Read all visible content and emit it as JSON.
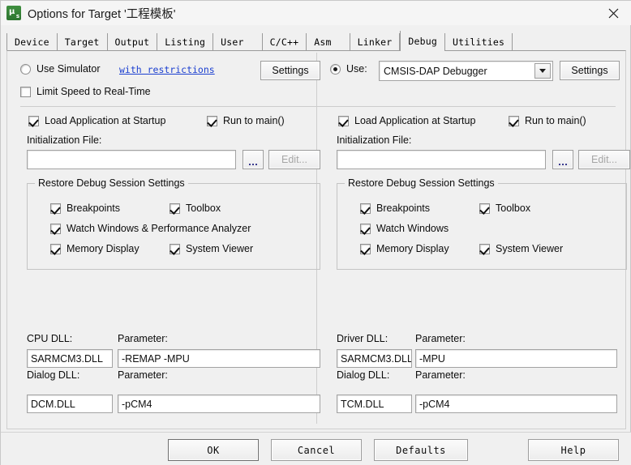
{
  "window": {
    "title": "Options for Target '工程模板'",
    "icon": "uvision-icon",
    "close_label": "✕"
  },
  "tabs": [
    {
      "label": "Device",
      "active": false
    },
    {
      "label": "Target",
      "active": false
    },
    {
      "label": "Output",
      "active": false
    },
    {
      "label": "Listing",
      "active": false
    },
    {
      "label": "User",
      "active": false
    },
    {
      "label": "C/C++",
      "active": false
    },
    {
      "label": "Asm",
      "active": false
    },
    {
      "label": "Linker",
      "active": false
    },
    {
      "label": "Debug",
      "active": true
    },
    {
      "label": "Utilities",
      "active": false
    }
  ],
  "left": {
    "use_simulator_label": "Use Simulator",
    "use_simulator_checked": false,
    "restrictions_link": "with restrictions",
    "settings_label": "Settings",
    "limit_speed_label": "Limit Speed to Real-Time",
    "limit_speed_checked": false,
    "load_app_label": "Load Application at Startup",
    "load_app_checked": true,
    "run_to_main_label": "Run to main()",
    "run_to_main_checked": true,
    "init_file_label": "Initialization File:",
    "init_file_value": "",
    "browse_label": "...",
    "edit_label": "Edit...",
    "edit_disabled": true,
    "restore_group_title": "Restore Debug Session Settings",
    "restore_items": [
      {
        "label": "Breakpoints",
        "checked": true
      },
      {
        "label": "Toolbox",
        "checked": true
      },
      {
        "label": "Watch Windows & Performance Analyzer",
        "checked": true
      },
      {
        "label": "Memory Display",
        "checked": true
      },
      {
        "label": "System Viewer",
        "checked": true
      }
    ],
    "cpu_dll_label": "CPU DLL:",
    "cpu_dll_value": "SARMCM3.DLL",
    "cpu_param_label": "Parameter:",
    "cpu_param_value": "-REMAP -MPU",
    "dialog_dll_label": "Dialog DLL:",
    "dialog_dll_value": "DCM.DLL",
    "dialog_param_label": "Parameter:",
    "dialog_param_value": "-pCM4"
  },
  "right": {
    "use_label": "Use:",
    "use_checked": true,
    "debugger_value": "CMSIS-DAP Debugger",
    "settings_label": "Settings",
    "load_app_label": "Load Application at Startup",
    "load_app_checked": true,
    "run_to_main_label": "Run to main()",
    "run_to_main_checked": true,
    "init_file_label": "Initialization File:",
    "init_file_value": "",
    "browse_label": "...",
    "edit_label": "Edit...",
    "edit_disabled": true,
    "restore_group_title": "Restore Debug Session Settings",
    "restore_items": [
      {
        "label": "Breakpoints",
        "checked": true
      },
      {
        "label": "Toolbox",
        "checked": true
      },
      {
        "label": "Watch Windows",
        "checked": true
      },
      {
        "label": "Memory Display",
        "checked": true
      },
      {
        "label": "System Viewer",
        "checked": true
      }
    ],
    "driver_dll_label": "Driver DLL:",
    "driver_dll_value": "SARMCM3.DLL",
    "driver_param_label": "Parameter:",
    "driver_param_value": "-MPU",
    "dialog_dll_label": "Dialog DLL:",
    "dialog_dll_value": "TCM.DLL",
    "dialog_param_label": "Parameter:",
    "dialog_param_value": "-pCM4"
  },
  "footer": {
    "ok": "OK",
    "cancel": "Cancel",
    "defaults": "Defaults",
    "help": "Help"
  },
  "colors": {
    "dialog_bg": "#f0f0f0",
    "link": "#1b3fd0",
    "icon_green": "#2e7530",
    "border": "#c4c4c4"
  }
}
